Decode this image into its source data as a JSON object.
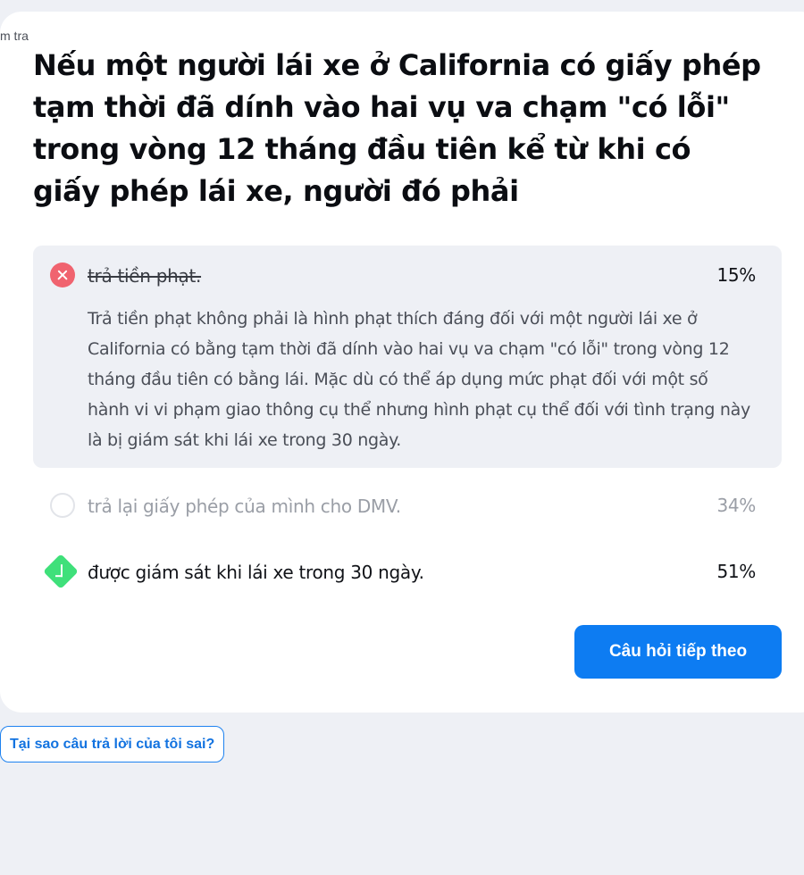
{
  "breadcrumb": "m tra",
  "question": "Nếu một người lái xe ở California có giấy phép tạm thời đã dính vào hai vụ va chạm \"có lỗi\" trong vòng 12 tháng đầu tiên kể từ khi có giấy phép lái xe, người đó phải",
  "options": [
    {
      "label": "trả tiền phạt.",
      "percent": "15%",
      "status": "wrong",
      "icon": "x-circle-icon",
      "explanation": "Trả tiền phạt không phải là hình phạt thích đáng đối với một người lái xe ở California có bằng tạm thời đã dính vào hai vụ va chạm \"có lỗi\" trong vòng 12 tháng đầu tiên có bằng lái. Mặc dù có thể áp dụng mức phạt đối với một số hành vi vi phạm giao thông cụ thể nhưng hình phạt cụ thể đối với tình trạng này là bị giám sát khi lái xe trong 30 ngày."
    },
    {
      "label": "trả lại giấy phép của mình cho DMV.",
      "percent": "34%",
      "status": "unselected",
      "icon": "empty-circle-icon"
    },
    {
      "label": "được giám sát khi lái xe trong 30 ngày.",
      "percent": "51%",
      "status": "correct",
      "icon": "check-diamond-icon"
    }
  ],
  "next_button": "Câu hỏi tiếp theo",
  "why_button": "Tại sao câu trả lời của tôi sai?",
  "colors": {
    "wrong": "#f0636f",
    "correct": "#3fe07a",
    "primary": "#0d7cf2",
    "panel": "#eef0f5"
  }
}
